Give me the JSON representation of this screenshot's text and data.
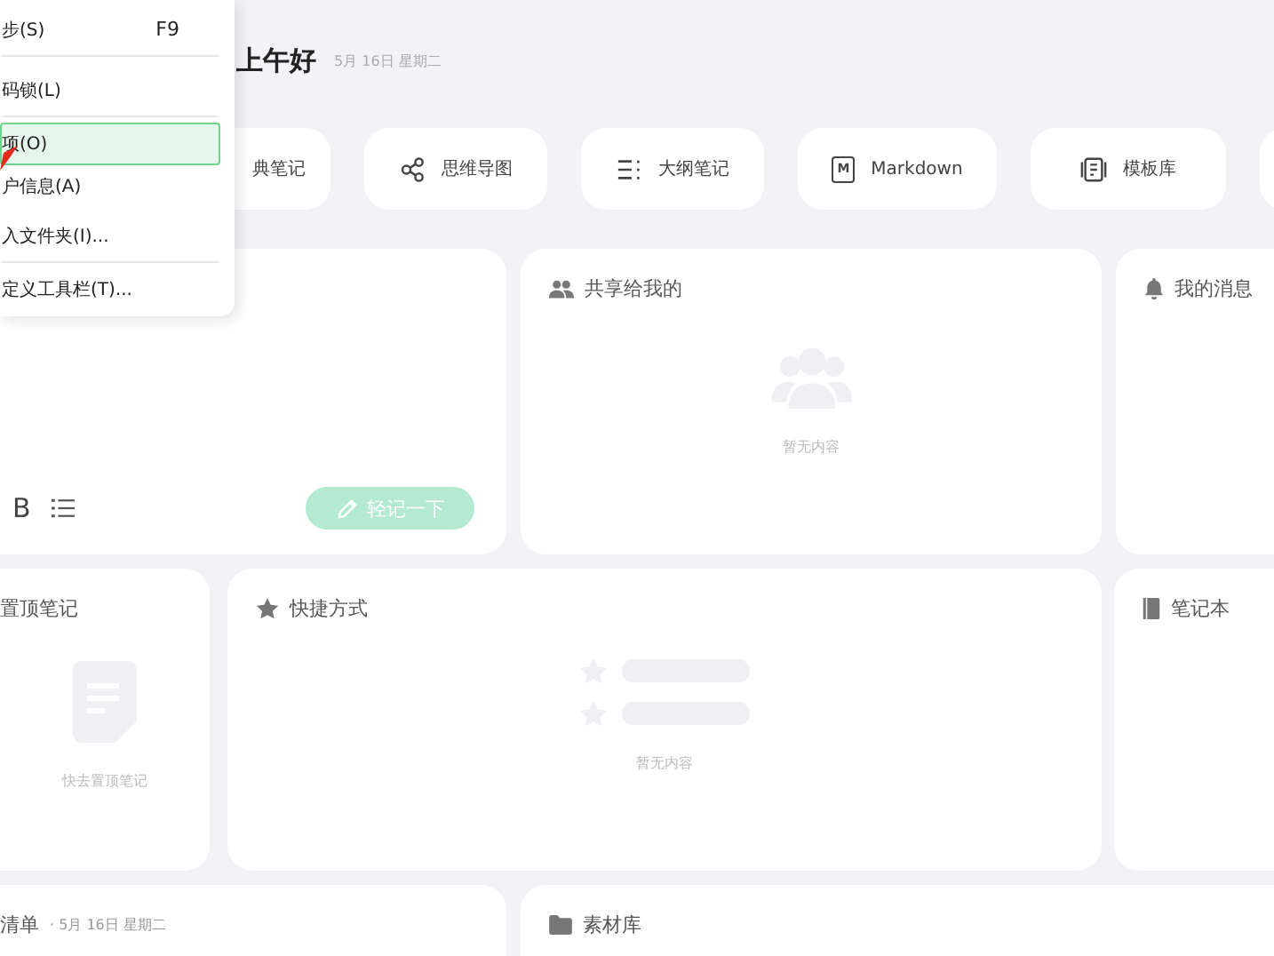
{
  "context_menu": {
    "items": [
      {
        "label": "步(S)",
        "shortcut": "F9",
        "selected": false,
        "separator_after": true
      },
      {
        "label": "码锁(L)",
        "selected": false,
        "separator_after": true
      },
      {
        "label": "项(O)",
        "selected": true,
        "separator_after": false
      },
      {
        "label": "户信息(A)",
        "selected": false,
        "separator_after": false
      },
      {
        "label": "入文件夹(I)...",
        "selected": false,
        "separator_after": true
      },
      {
        "label": "定义工具栏(T)...",
        "selected": false,
        "separator_after": false
      }
    ]
  },
  "greeting": {
    "title": "上午好",
    "date": "5月 16日 星期二"
  },
  "quick_actions": [
    {
      "kind": "classic",
      "label": "典笔记"
    },
    {
      "kind": "mindmap",
      "label": "思维导图"
    },
    {
      "kind": "outline",
      "label": "大纲笔记"
    },
    {
      "kind": "markdown",
      "label": "Markdown",
      "icon_text": "M"
    },
    {
      "kind": "template",
      "label": "模板库"
    },
    {
      "kind": "blank"
    }
  ],
  "quick_note": {
    "format_buttons": [
      "B"
    ],
    "button": "轻记一下"
  },
  "shared": {
    "title": "共享给我的",
    "empty": "暂无内容"
  },
  "messages": {
    "title": "我的消息"
  },
  "pinned": {
    "title": "置顶笔记",
    "hint": "快去置顶笔记"
  },
  "shortcuts": {
    "title": "快捷方式",
    "empty": "暂无内容"
  },
  "notebooks": {
    "title": "笔记本"
  },
  "checklist": {
    "title": "清单",
    "date": "· 5月 16日 星期二"
  },
  "materials": {
    "title": "素材库"
  }
}
